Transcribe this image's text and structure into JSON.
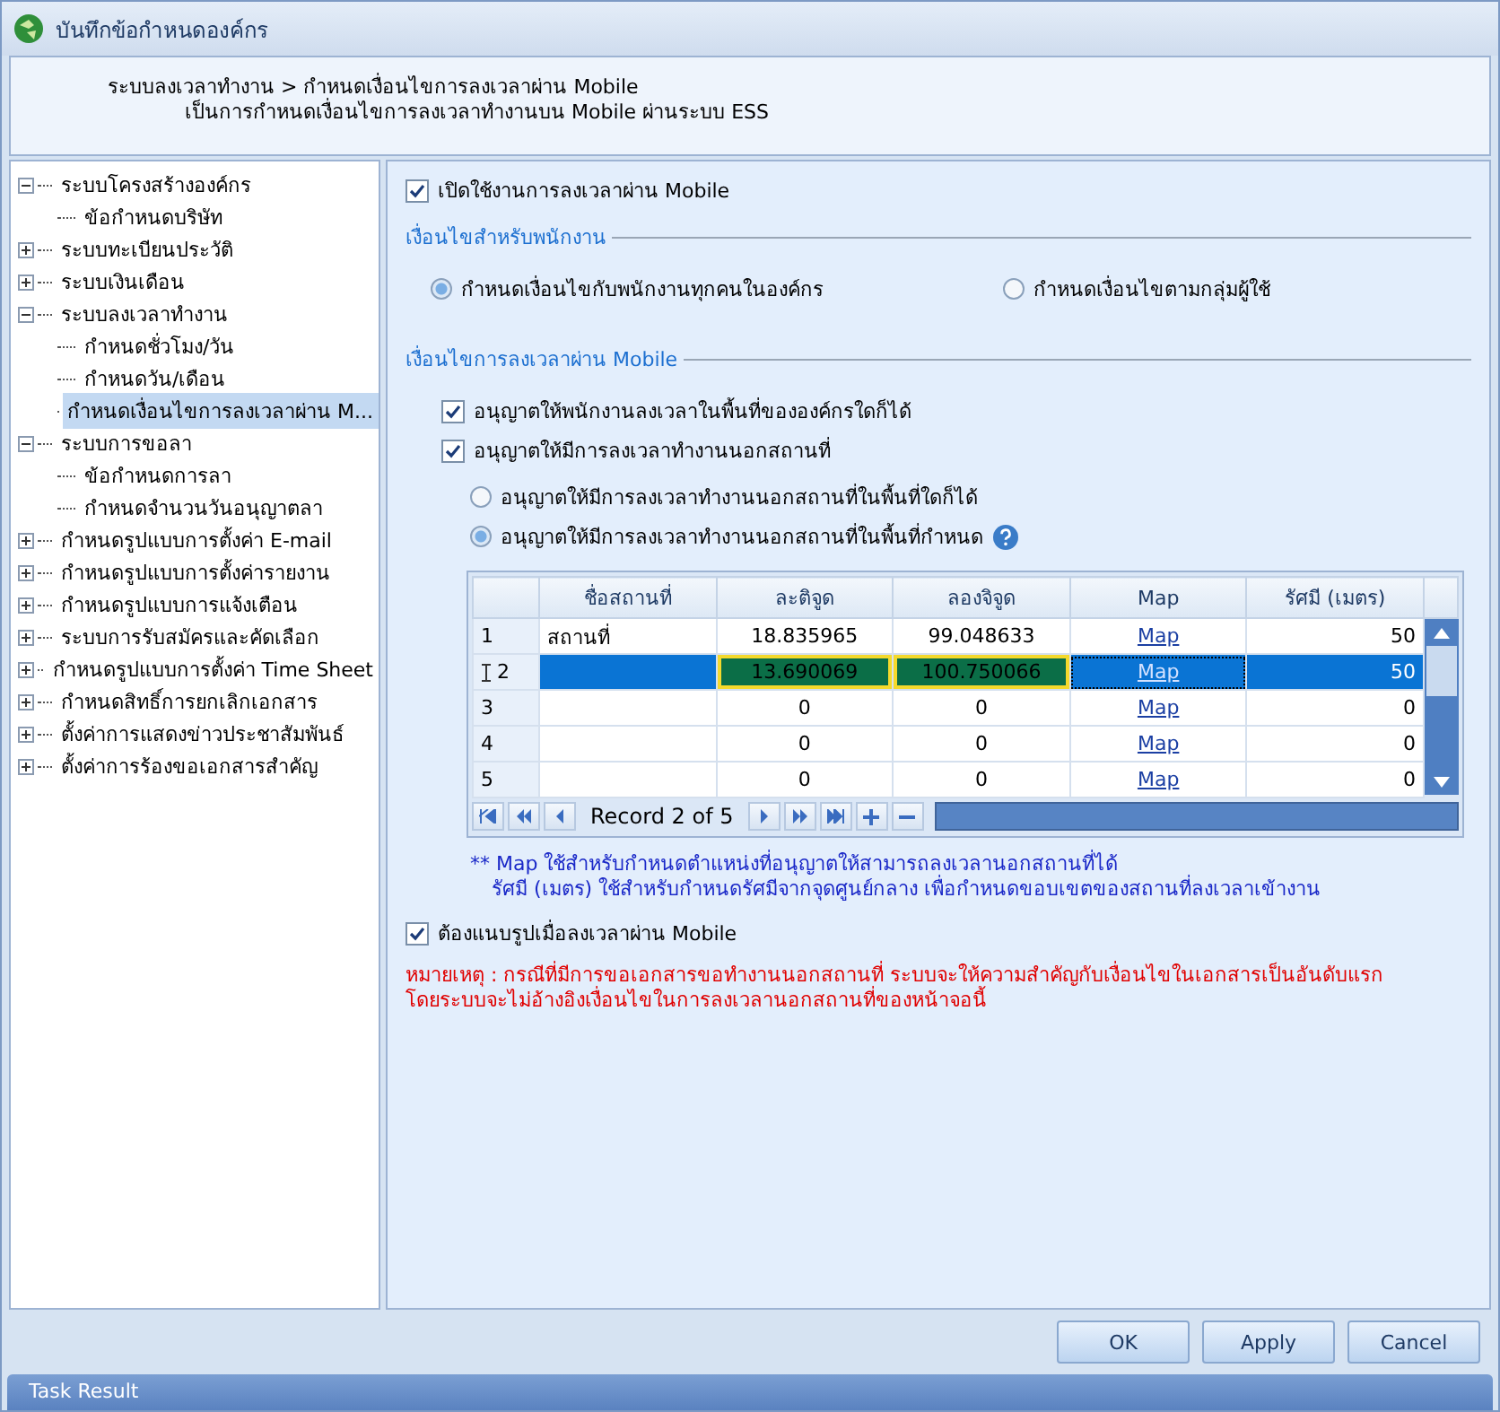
{
  "window": {
    "title": "บันทึกข้อกำหนดองค์กร"
  },
  "header": {
    "breadcrumb": "ระบบลงเวลาทำงาน > กำหนดเงื่อนไขการลงเวลาผ่าน Mobile",
    "description": "เป็นการกำหนดเงื่อนไขการลงเวลาทำงานบน Mobile ผ่านระบบ ESS"
  },
  "tree": [
    {
      "label": "ระบบโครงสร้างองค์กร",
      "expanded": true,
      "selected": false,
      "children": [
        {
          "label": "ข้อกำหนดบริษัท",
          "selected": false
        }
      ]
    },
    {
      "label": "ระบบทะเบียนประวัติ",
      "expanded": false,
      "selected": false
    },
    {
      "label": "ระบบเงินเดือน",
      "expanded": false,
      "selected": false
    },
    {
      "label": "ระบบลงเวลาทำงาน",
      "expanded": true,
      "selected": false,
      "children": [
        {
          "label": "กำหนดชั่วโมง/วัน",
          "selected": false
        },
        {
          "label": "กำหนดวัน/เดือน",
          "selected": false
        },
        {
          "label": "กำหนดเงื่อนไขการลงเวลาผ่าน M...",
          "selected": true
        }
      ]
    },
    {
      "label": "ระบบการขอลา",
      "expanded": true,
      "selected": false,
      "children": [
        {
          "label": "ข้อกำหนดการลา",
          "selected": false
        },
        {
          "label": "กำหนดจำนวนวันอนุญาตลา",
          "selected": false
        }
      ]
    },
    {
      "label": "กำหนดรูปแบบการตั้งค่า E-mail",
      "expanded": false,
      "selected": false
    },
    {
      "label": "กำหนดรูปแบบการตั้งค่ารายงาน",
      "expanded": false,
      "selected": false
    },
    {
      "label": "กำหนดรูปแบบการแจ้งเตือน",
      "expanded": false,
      "selected": false
    },
    {
      "label": "ระบบการรับสมัครและคัดเลือก",
      "expanded": false,
      "selected": false
    },
    {
      "label": "กำหนดรูปแบบการตั้งค่า Time Sheet",
      "expanded": false,
      "selected": false
    },
    {
      "label": "กำหนดสิทธิ์การยกเลิกเอกสาร",
      "expanded": false,
      "selected": false
    },
    {
      "label": "ตั้งค่าการแสดงข่าวประชาสัมพันธ์",
      "expanded": false,
      "selected": false
    },
    {
      "label": "ตั้งค่าการร้องขอเอกสารสำคัญ",
      "expanded": false,
      "selected": false
    }
  ],
  "enable_mobile": {
    "label": "เปิดใช้งานการลงเวลาผ่าน Mobile",
    "checked": true
  },
  "employee_section": {
    "title": "เงื่อนไขสำหรับพนักงาน",
    "options": [
      {
        "label": "กำหนดเงื่อนไขกับพนักงานทุกคนในองค์กร",
        "selected": true
      },
      {
        "label": "กำหนดเงื่อนไขตามกลุ่มผู้ใช้",
        "selected": false
      }
    ]
  },
  "mobile_section": {
    "title": "เงื่อนไขการลงเวลาผ่าน Mobile",
    "checks": [
      {
        "label": "อนุญาตให้พนักงานลงเวลาในพื้นที่ขององค์กรใดก็ได้",
        "checked": true
      },
      {
        "label": "อนุญาตให้มีการลงเวลาทำงานนอกสถานที่",
        "checked": true
      }
    ],
    "options": [
      {
        "label": "อนุญาตให้มีการลงเวลาทำงานนอกสถานที่ในพื้นที่ใดก็ได้",
        "selected": false
      },
      {
        "label": "อนุญาตให้มีการลงเวลาทำงานนอกสถานที่ในพื้นที่กำหนด",
        "selected": true
      }
    ]
  },
  "table": {
    "columns": [
      "ชื่อสถานที่",
      "ละติจูด",
      "ลองจิจูด",
      "Map",
      "รัศมี (เมตร)"
    ],
    "rows": [
      {
        "number": "1",
        "name": "สถานที่",
        "lat": "18.835965",
        "lng": "99.048633",
        "map": "Map",
        "radius": "50",
        "selected": false,
        "highlighted": false
      },
      {
        "number": "2",
        "name": "",
        "lat": "13.690069",
        "lng": "100.750066",
        "map": "Map",
        "radius": "50",
        "selected": true,
        "highlighted": true
      },
      {
        "number": "3",
        "name": "",
        "lat": "0",
        "lng": "0",
        "map": "Map",
        "radius": "0",
        "selected": false,
        "highlighted": false
      },
      {
        "number": "4",
        "name": "",
        "lat": "0",
        "lng": "0",
        "map": "Map",
        "radius": "0",
        "selected": false,
        "highlighted": false
      },
      {
        "number": "5",
        "name": "",
        "lat": "0",
        "lng": "0",
        "map": "Map",
        "radius": "0",
        "selected": false,
        "highlighted": false
      }
    ],
    "record": "Record 2 of 5"
  },
  "notes": [
    "** Map ใช้สำหรับกำหนดตำแหน่งที่อนุญาตให้สามารถลงเวลานอกสถานที่ได้",
    "รัศมี (เมตร) ใช้สำหรับกำหนดรัศมีจากจุดศูนย์กลาง เพื่อกำหนดขอบเขตของสถานที่ลงเวลาเข้างาน"
  ],
  "photo_required": {
    "label": "ต้องแนบรูปเมื่อลงเวลาผ่าน Mobile",
    "checked": true
  },
  "remark": [
    "หมายเหตุ : กรณีที่มีการขอเอกสารขอทำงานนอกสถานที่ ระบบจะให้ความสำคัญกับเงื่อนไขในเอกสารเป็นอันดับแรก",
    "โดยระบบจะไม่อ้างอิงเงื่อนไขในการลงเวลานอกสถานที่ของหน้าจอนี้"
  ],
  "buttons": [
    "OK",
    "Apply",
    "Cancel"
  ],
  "status_bar": "Task Result"
}
